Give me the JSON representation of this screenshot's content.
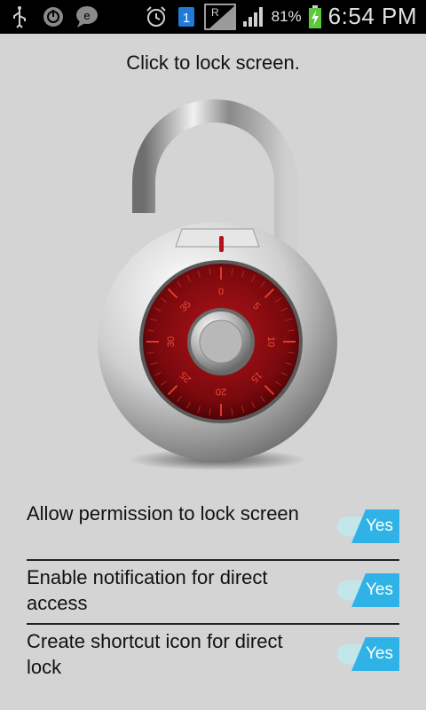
{
  "statusbar": {
    "left_icons": [
      "usb-icon",
      "power-icon",
      "chat-icon"
    ],
    "right_icons": [
      "alarm-icon",
      "sim1-icon",
      "roaming-signal-icon",
      "signal-icon",
      "battery-charging-icon"
    ],
    "roaming_label": "R",
    "sim_label": "1",
    "battery": "81%",
    "time": "6:54 PM"
  },
  "title": "Click to lock screen.",
  "lock": {
    "dial_numbers": [
      "0",
      "5",
      "10",
      "15",
      "20",
      "25",
      "30",
      "35"
    ],
    "colors": {
      "dial": "#8a0c10",
      "body": "#c8c8c8",
      "shackle": "#9a9a9a"
    }
  },
  "settings": [
    {
      "label": "Allow permission to lock screen",
      "toggle": "Yes"
    },
    {
      "label": "Enable notification for direct access",
      "toggle": "Yes"
    },
    {
      "label": "Create shortcut icon for direct lock",
      "toggle": "Yes"
    }
  ],
  "accent": "#2fb3e6"
}
